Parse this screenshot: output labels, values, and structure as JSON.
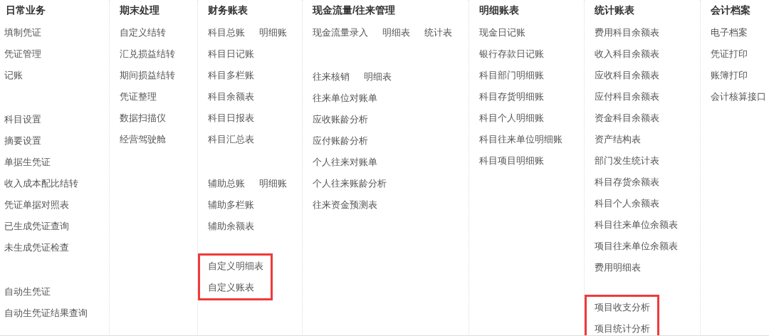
{
  "columns": [
    {
      "title": "日常业务",
      "groups": [
        {
          "highlighted": false,
          "rows": [
            [
              "填制凭证"
            ],
            [
              "凭证管理"
            ],
            [
              "记账"
            ]
          ]
        },
        {
          "highlighted": false,
          "rows": [
            [
              "科目设置"
            ],
            [
              "摘要设置"
            ],
            [
              "单据生凭证"
            ],
            [
              "收入成本配比结转"
            ],
            [
              "凭证单据对照表"
            ],
            [
              "已生成凭证查询"
            ],
            [
              "未生成凭证检查"
            ]
          ]
        },
        {
          "highlighted": false,
          "rows": [
            [
              "自动生凭证"
            ],
            [
              "自动生凭证结果查询"
            ]
          ]
        }
      ]
    },
    {
      "title": "期末处理",
      "groups": [
        {
          "highlighted": false,
          "rows": [
            [
              "自定义结转"
            ],
            [
              "汇兑损益结转"
            ],
            [
              "期间损益结转"
            ],
            [
              "凭证整理"
            ],
            [
              "数据扫描仪"
            ],
            [
              "经营驾驶舱"
            ]
          ]
        }
      ]
    },
    {
      "title": "财务账表",
      "groups": [
        {
          "highlighted": false,
          "rows": [
            [
              "科目总账",
              "明细账"
            ],
            [
              "科目日记账"
            ],
            [
              "科目多栏账"
            ],
            [
              "科目余额表"
            ],
            [
              "科目日报表"
            ],
            [
              "科目汇总表"
            ]
          ]
        },
        {
          "highlighted": false,
          "rows": [
            [
              "辅助总账",
              "明细账"
            ],
            [
              "辅助多栏账"
            ],
            [
              "辅助余额表"
            ]
          ]
        },
        {
          "highlighted": true,
          "rows": [
            [
              "自定义明细表"
            ],
            [
              "自定义账表"
            ]
          ]
        }
      ]
    },
    {
      "title": "现金流量/往来管理",
      "groups": [
        {
          "highlighted": false,
          "rows": [
            [
              "现金流量录入",
              "明细表",
              "统计表"
            ]
          ]
        },
        {
          "highlighted": false,
          "rows": [
            [
              "往来核销",
              "明细表"
            ],
            [
              "往来单位对账单"
            ],
            [
              "应收账龄分析"
            ],
            [
              "应付账龄分析"
            ],
            [
              "个人往来对账单"
            ],
            [
              "个人往来账龄分析"
            ],
            [
              "往来资金预测表"
            ]
          ]
        }
      ]
    },
    {
      "title": "明细账表",
      "groups": [
        {
          "highlighted": false,
          "rows": [
            [
              "现金日记账"
            ],
            [
              "银行存款日记账"
            ],
            [
              "科目部门明细账"
            ],
            [
              "科目存货明细账"
            ],
            [
              "科目个人明细账"
            ],
            [
              "科目往来单位明细账"
            ],
            [
              "科目项目明细账"
            ]
          ]
        }
      ]
    },
    {
      "title": "统计账表",
      "groups": [
        {
          "highlighted": false,
          "rows": [
            [
              "费用科目余额表"
            ],
            [
              "收入科目余额表"
            ],
            [
              "应收科目余额表"
            ],
            [
              "应付科目余额表"
            ],
            [
              "资金科目余额表"
            ],
            [
              "资产结构表"
            ],
            [
              "部门发生统计表"
            ],
            [
              "科目存货余额表"
            ],
            [
              "科目个人余额表"
            ],
            [
              "科目往来单位余额表"
            ],
            [
              "项目往来单位余额表"
            ],
            [
              "费用明细表"
            ]
          ]
        },
        {
          "highlighted": true,
          "rows": [
            [
              "项目收支分析"
            ],
            [
              "项目统计分析"
            ]
          ]
        }
      ]
    },
    {
      "title": "会计档案",
      "groups": [
        {
          "highlighted": false,
          "rows": [
            [
              "电子档案"
            ],
            [
              "凭证打印"
            ],
            [
              "账簿打印"
            ],
            [
              "会计核算接口"
            ]
          ]
        }
      ]
    }
  ]
}
